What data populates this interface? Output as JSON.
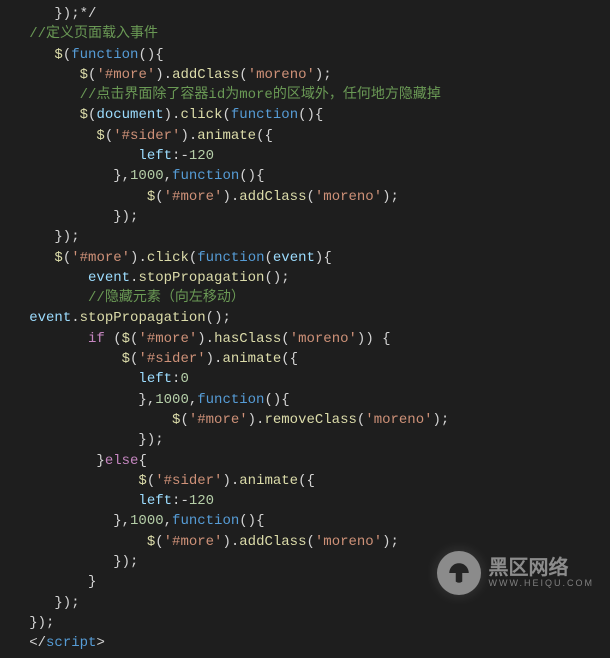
{
  "code": {
    "l1a": "      });*/",
    "l2a": "   ",
    "l2b": "//定义页面载入事件",
    "l3a": "      ",
    "l3b": "$",
    "l3c": "(",
    "l3d": "function",
    "l3e": "(){",
    "l4a": "         ",
    "l4b": "$",
    "l4c": "(",
    "l4d": "'#more'",
    "l4e": ").",
    "l4f": "addClass",
    "l4g": "(",
    "l4h": "'moreno'",
    "l4i": ");",
    "l5a": "         ",
    "l5b": "//点击界面除了容器id为more的区域外，任何地方隐藏掉",
    "l6a": "         ",
    "l6b": "$",
    "l6c": "(",
    "l6d": "document",
    "l6e": ").",
    "l6f": "click",
    "l6g": "(",
    "l6h": "function",
    "l6i": "(){",
    "l7a": "           ",
    "l7b": "$",
    "l7c": "(",
    "l7d": "'#sider'",
    "l7e": ").",
    "l7f": "animate",
    "l7g": "({",
    "l8a": "                ",
    "l8b": "left",
    "l8c": ":",
    "l8d": "-",
    "l8e": "120",
    "l9a": "             },",
    "l9b": "1000",
    "l9c": ",",
    "l9d": "function",
    "l9e": "(){",
    "l10a": "                 ",
    "l10b": "$",
    "l10c": "(",
    "l10d": "'#more'",
    "l10e": ").",
    "l10f": "addClass",
    "l10g": "(",
    "l10h": "'moreno'",
    "l10i": ");",
    "l11a": "             });",
    "l12a": "      });",
    "l13a": "      ",
    "l13b": "$",
    "l13c": "(",
    "l13d": "'#more'",
    "l13e": ").",
    "l13f": "click",
    "l13g": "(",
    "l13h": "function",
    "l13i": "(",
    "l13j": "event",
    "l13k": "){",
    "l14a": "          ",
    "l14b": "event",
    "l14c": ".",
    "l14d": "stopPropagation",
    "l14e": "();",
    "l15a": "          ",
    "l15b": "//隐藏元素（向左移动）",
    "l16a": "   ",
    "l16b": "event",
    "l16c": ".",
    "l16d": "stopPropagation",
    "l16e": "();",
    "l17a": "          ",
    "l17b": "if",
    "l17c": " (",
    "l17d": "$",
    "l17e": "(",
    "l17f": "'#more'",
    "l17g": ").",
    "l17h": "hasClass",
    "l17i": "(",
    "l17j": "'moreno'",
    "l17k": ")) {",
    "l18a": "              ",
    "l18b": "$",
    "l18c": "(",
    "l18d": "'#sider'",
    "l18e": ").",
    "l18f": "animate",
    "l18g": "({",
    "l19a": "                ",
    "l19b": "left",
    "l19c": ":",
    "l19d": "0",
    "l20a": "                },",
    "l20b": "1000",
    "l20c": ",",
    "l20d": "function",
    "l20e": "(){",
    "l21a": "                    ",
    "l21b": "$",
    "l21c": "(",
    "l21d": "'#more'",
    "l21e": ").",
    "l21f": "removeClass",
    "l21g": "(",
    "l21h": "'moreno'",
    "l21i": ");",
    "l22a": "                });",
    "l23a": "           }",
    "l23b": "else",
    "l23c": "{",
    "l24a": "                ",
    "l24b": "$",
    "l24c": "(",
    "l24d": "'#sider'",
    "l24e": ").",
    "l24f": "animate",
    "l24g": "({",
    "l25a": "                ",
    "l25b": "left",
    "l25c": ":",
    "l25d": "-",
    "l25e": "120",
    "l26a": "             },",
    "l26b": "1000",
    "l26c": ",",
    "l26d": "function",
    "l26e": "(){",
    "l27a": "                 ",
    "l27b": "$",
    "l27c": "(",
    "l27d": "'#more'",
    "l27e": ").",
    "l27f": "addClass",
    "l27g": "(",
    "l27h": "'moreno'",
    "l27i": ");",
    "l28a": "             });",
    "l29a": "          }",
    "l30a": "      });",
    "l31a": "   });",
    "l32a": "   </",
    "l32b": "script",
    "l32c": ">"
  },
  "watermark": {
    "title": "黑区网络",
    "sub": "WWW.HEIQU.COM"
  }
}
